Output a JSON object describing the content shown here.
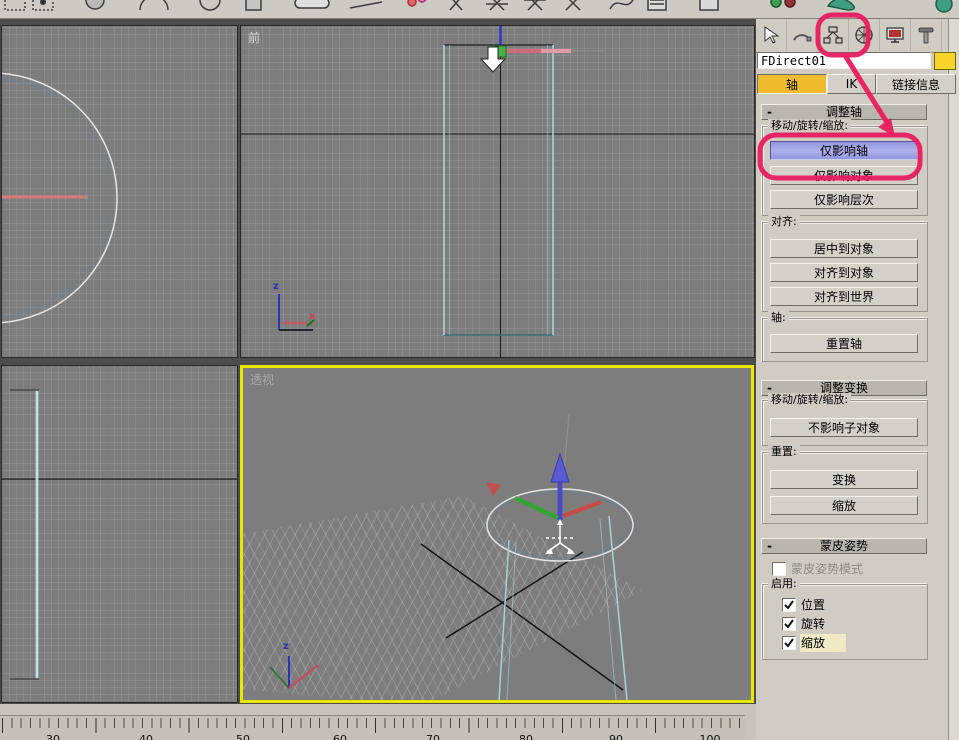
{
  "toolbar": {
    "icons": [
      "marquee-rect",
      "marquee-fence",
      "sphere",
      "arc-rotate",
      "ring",
      "box",
      "capsule",
      "line",
      "snap-pink",
      "mirror",
      "align-x1",
      "align-x2",
      "align-x3",
      "abc-named-selection",
      "curve",
      "list-view",
      "window",
      "spheres-pair",
      "teapot",
      "sphere-far-right"
    ]
  },
  "command_panel": {
    "tabs": [
      {
        "id": "create",
        "icon": "arrow-cursor-icon",
        "selected": false
      },
      {
        "id": "modify",
        "icon": "modify-arc-icon",
        "selected": false
      },
      {
        "id": "hierarchy",
        "icon": "hierarchy-tree-icon",
        "selected": true,
        "annotated": true
      },
      {
        "id": "motion",
        "icon": "motion-wheel-icon",
        "selected": false
      },
      {
        "id": "display",
        "icon": "display-monitor-icon",
        "selected": false
      },
      {
        "id": "utilities",
        "icon": "utilities-hammer-icon",
        "selected": false
      }
    ],
    "object_name": "FDirect01",
    "color_swatch": "#f6d42b",
    "sub_tabs": [
      {
        "label": "轴",
        "active": true
      },
      {
        "label": "IK",
        "active": false
      },
      {
        "label": "链接信息",
        "active": false
      }
    ],
    "rollouts": [
      {
        "title": "调整轴",
        "collapse": "-",
        "groups": [
          {
            "label": "移动/旋转/缩放:",
            "buttons": [
              {
                "label": "仅影响轴",
                "active": true,
                "annotated": true
              },
              {
                "label": "仅影响对象",
                "active": false
              },
              {
                "label": "仅影响层次",
                "active": false
              }
            ]
          },
          {
            "label": "对齐:",
            "buttons": [
              {
                "label": "居中到对象",
                "active": false
              },
              {
                "label": "对齐到对象",
                "active": false
              },
              {
                "label": "对齐到世界",
                "active": false
              }
            ]
          },
          {
            "label": "轴:",
            "buttons": [
              {
                "label": "重置轴",
                "active": false
              }
            ]
          }
        ]
      },
      {
        "title": "调整变换",
        "collapse": "-",
        "groups": [
          {
            "label": "移动/旋转/缩放:",
            "buttons": [
              {
                "label": "不影响子对象",
                "active": false
              }
            ]
          },
          {
            "label": "重置:",
            "buttons": [
              {
                "label": "变换",
                "active": false
              },
              {
                "label": "缩放",
                "active": false
              }
            ]
          }
        ]
      },
      {
        "title": "蒙皮姿势",
        "collapse": "-",
        "mode_checkbox": {
          "label": "蒙皮姿势模式",
          "checked": false,
          "disabled": true
        },
        "enable_group": {
          "label": "启用:",
          "checkboxes": [
            {
              "label": "位置",
              "checked": true
            },
            {
              "label": "旋转",
              "checked": true
            },
            {
              "label": "缩放",
              "checked": true
            }
          ]
        }
      }
    ]
  },
  "viewports": {
    "front": {
      "label": "前"
    },
    "perspective": {
      "label": "透视",
      "active": true,
      "border_color": "#e6e600"
    },
    "axis_labels": {
      "z": "z",
      "x": "x"
    }
  },
  "timeline": {
    "labels": [
      "30",
      "40",
      "50",
      "60",
      "70",
      "80",
      "90",
      "100"
    ]
  },
  "annotations": {
    "color": "#ea1d5f",
    "highlighted_button": "仅影响轴",
    "highlighted_tab": "hierarchy"
  },
  "colors": {
    "active_button": "#9a9ee8",
    "active_tab_yellow": "#eebc2c",
    "viewport_bg": "#7d7d7d",
    "panel_bg": "#d0ccc4"
  }
}
